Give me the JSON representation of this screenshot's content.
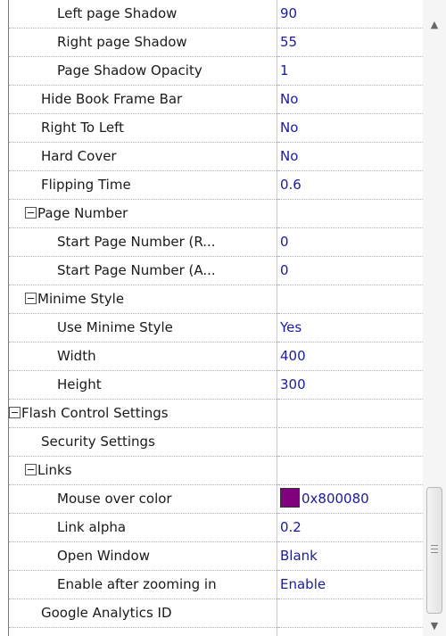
{
  "rows": [
    {
      "label": "Left page Shadow",
      "value": "90"
    },
    {
      "label": "Right page Shadow",
      "value": "55"
    },
    {
      "label": "Page Shadow Opacity",
      "value": "1"
    },
    {
      "label": "Hide Book Frame Bar",
      "value": "No"
    },
    {
      "label": "Right To Left",
      "value": "No"
    },
    {
      "label": "Hard Cover",
      "value": "No"
    },
    {
      "label": "Flipping Time",
      "value": "0.6"
    },
    {
      "label": "Page Number",
      "value": ""
    },
    {
      "label": "Start Page Number (R...",
      "value": "0"
    },
    {
      "label": "Start Page Number (A...",
      "value": "0"
    },
    {
      "label": "Minime Style",
      "value": ""
    },
    {
      "label": "Use Minime Style",
      "value": "Yes"
    },
    {
      "label": "Width",
      "value": "400"
    },
    {
      "label": "Height",
      "value": "300"
    },
    {
      "label": "Flash Control Settings",
      "value": ""
    },
    {
      "label": "Security Settings",
      "value": ""
    },
    {
      "label": "Links",
      "value": ""
    },
    {
      "label": "Mouse over color",
      "value": "0x800080"
    },
    {
      "label": "Link alpha",
      "value": "0.2"
    },
    {
      "label": "Open Window",
      "value": "Blank"
    },
    {
      "label": "Enable after zooming in",
      "value": "Enable"
    },
    {
      "label": "Google Analytics ID",
      "value": ""
    }
  ],
  "colors": {
    "value_text": "#1b1b9e",
    "mouse_over_swatch": "#800080"
  },
  "icons": {
    "expander": "collapse-minus-box-icon",
    "scroll_up": "scroll-up-arrow-icon",
    "scroll_down": "scroll-down-arrow-icon"
  }
}
